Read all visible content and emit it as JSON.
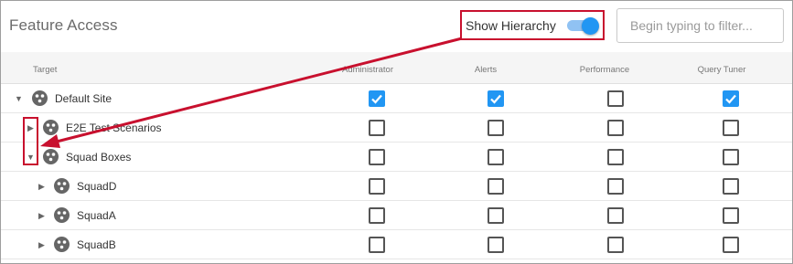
{
  "header": {
    "title": "Feature Access",
    "show_hierarchy_label": "Show Hierarchy",
    "show_hierarchy_on": true,
    "filter_placeholder": "Begin typing to filter..."
  },
  "columns": {
    "target": "Target",
    "administrator": "Administrator",
    "alerts": "Alerts",
    "performance": "Performance",
    "query_tuner": "Query Tuner"
  },
  "rows": [
    {
      "label": "Default Site",
      "expanded": true,
      "checks": [
        true,
        true,
        false,
        true
      ]
    },
    {
      "label": "E2E Test Scenarios",
      "expanded": false,
      "checks": [
        false,
        false,
        false,
        false
      ]
    },
    {
      "label": "Squad Boxes",
      "expanded": true,
      "checks": [
        false,
        false,
        false,
        false
      ]
    },
    {
      "label": "SquadD",
      "expanded": false,
      "checks": [
        false,
        false,
        false,
        false
      ]
    },
    {
      "label": "SquadA",
      "expanded": false,
      "checks": [
        false,
        false,
        false,
        false
      ]
    },
    {
      "label": "SquadB",
      "expanded": false,
      "checks": [
        false,
        false,
        false,
        false
      ]
    }
  ],
  "colors": {
    "accent": "#2196f3",
    "annotation": "#c8102e"
  }
}
